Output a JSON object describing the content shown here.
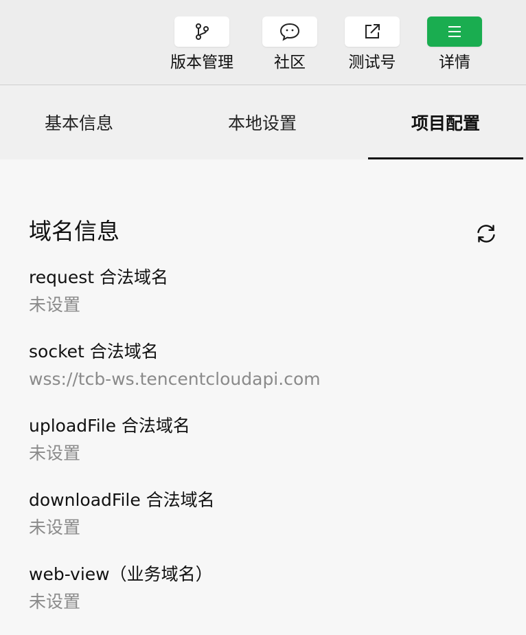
{
  "toolbar": {
    "items": [
      {
        "label": "版本管理",
        "icon": "git-branch-icon"
      },
      {
        "label": "社区",
        "icon": "chat-bubble-icon"
      },
      {
        "label": "测试号",
        "icon": "external-link-icon"
      },
      {
        "label": "详情",
        "icon": "menu-icon"
      }
    ],
    "accent_color": "#1aad50"
  },
  "tabs": [
    {
      "label": "基本信息"
    },
    {
      "label": "本地设置"
    },
    {
      "label": "项目配置",
      "active": true
    }
  ],
  "domain_section": {
    "title": "域名信息",
    "refresh_icon": "refresh-icon",
    "entries": [
      {
        "name": "request 合法域名",
        "value": "未设置"
      },
      {
        "name": "socket 合法域名",
        "value": "wss://tcb-ws.tencentcloudapi.com"
      },
      {
        "name": "uploadFile 合法域名",
        "value": "未设置"
      },
      {
        "name": "downloadFile 合法域名",
        "value": "未设置"
      },
      {
        "name": "web-view（业务域名）",
        "value": "未设置"
      }
    ]
  }
}
